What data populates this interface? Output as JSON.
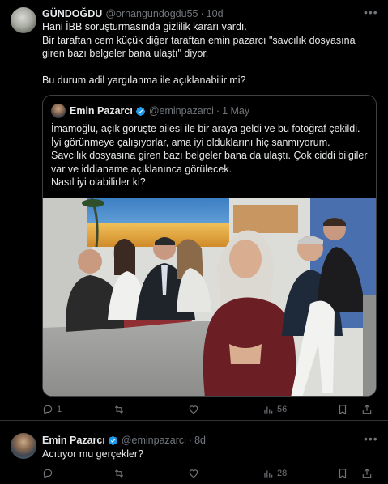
{
  "tweet1": {
    "name": "GÜNDOĞDU",
    "handle": "@orhangundogdu55",
    "time": "10d",
    "text": "Hani İBB soruşturmasında gizlilik kararı vardı.\nBir taraftan cem küçük diğer taraftan emin pazarcı \"savcılık dosyasına giren bazı belgeler bana ulaştı\"  diyor.\n\nBu durum adil yargılanma ile açıklanabilir mi?",
    "reply_count": "1",
    "retweet_count": "",
    "like_count": "",
    "views_count": "56"
  },
  "quote": {
    "name": "Emin Pazarcı",
    "handle": "@eminpazarci",
    "time": "1 May",
    "text": "İmamoğlu, açık görüşte ailesi ile bir araya geldi ve bu fotoğraf çekildi.\nİyi görünmeye çalışıyorlar, ama iyi olduklarını hiç sanmıyorum.\nSavcılık dosyasına giren bazı belgeler bana da ulaştı. Çok ciddi bilgiler var ve iddianame açıklanınca görülecek.\nNasıl iyi olabilirler ki?"
  },
  "tweet2": {
    "name": "Emin Pazarcı",
    "handle": "@eminpazarci",
    "time": "8d",
    "text": "Acıtıyor mu gerçekler?",
    "reply_count": "",
    "retweet_count": "",
    "like_count": "",
    "views_count": "28"
  },
  "separator": "·",
  "colors": {
    "background": "#000000",
    "text": "#e7e9ea",
    "muted": "#71767b",
    "verified": "#1d9bf0",
    "border": "#2f3336"
  },
  "icons": [
    "more-icon",
    "verified-badge-icon",
    "reply-icon",
    "retweet-icon",
    "like-icon",
    "views-icon",
    "bookmark-icon",
    "share-icon"
  ]
}
